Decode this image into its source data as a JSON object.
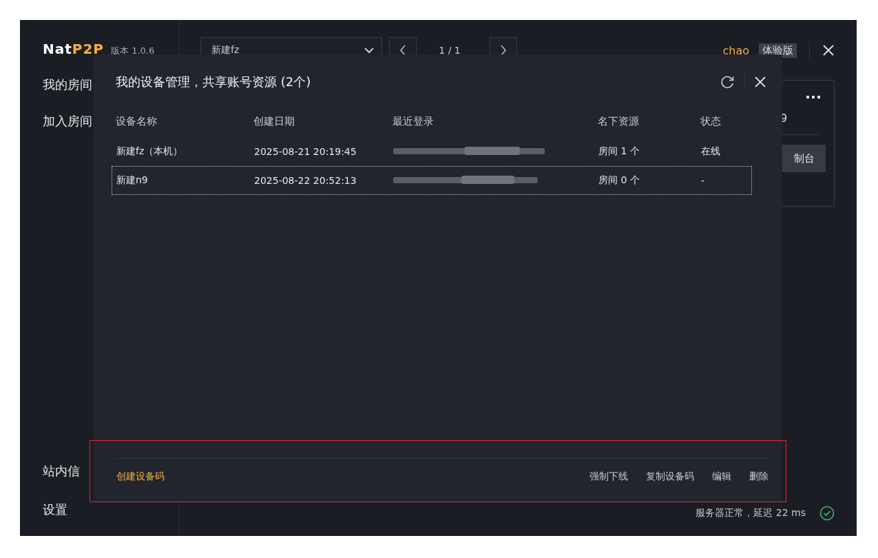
{
  "app": {
    "logo_main": "Nat",
    "logo_accent": "P2P",
    "version": "版本 1.0.6"
  },
  "sidebar": {
    "items": [
      "我的房间",
      "加入房间"
    ],
    "bottom_items": [
      "站内信",
      "设置"
    ]
  },
  "toolbar": {
    "device_select": "新建fz",
    "page": "1 / 1",
    "user": "chao",
    "badge": "体验版"
  },
  "room_card": {
    "name_fragment": "9",
    "button_fragment": "制台"
  },
  "status_bar": {
    "text": "服务器正常，延迟 22 ms",
    "ok": true
  },
  "dialog": {
    "title": "我的设备管理，共享账号资源 (2个)",
    "columns": [
      "设备名称",
      "创建日期",
      "最近登录",
      "名下资源",
      "状态"
    ],
    "rows": [
      {
        "name": "新建fz（本机）",
        "created": "2025-08-21 20:19:45",
        "last_login_redacted": true,
        "resources": "房间 1 个",
        "status": "在线",
        "selected": false
      },
      {
        "name": "新建n9",
        "created": "2025-08-22 20:52:13",
        "last_login_redacted": true,
        "resources": "房间 0 个",
        "status": "-",
        "selected": true
      }
    ],
    "footer_link": "创建设备码",
    "actions": [
      "强制下线",
      "复制设备码",
      "编辑",
      "删除"
    ],
    "highlighted_footer": true
  }
}
